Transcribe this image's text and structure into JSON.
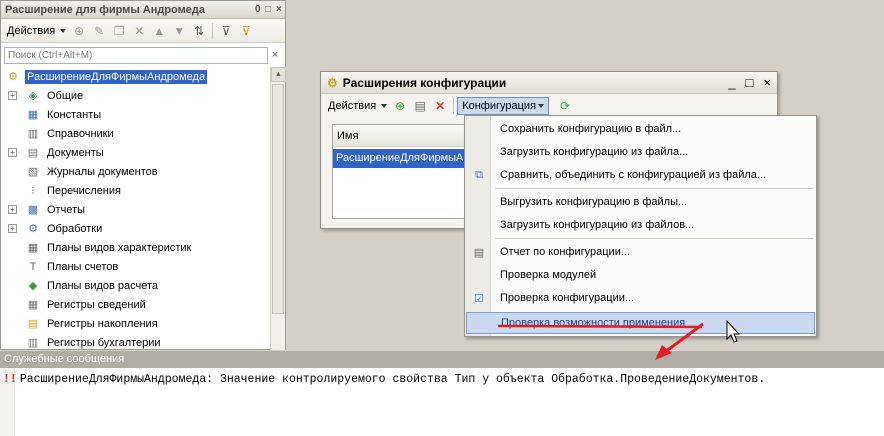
{
  "left_panel": {
    "title": "Расширение для фирмы Андромеда",
    "title_controls": [
      "0",
      "□",
      "×"
    ],
    "actions_label": "Действия",
    "search_placeholder": "Поиск (Ctrl+Alt+M)",
    "search_clear": "×",
    "tree": [
      {
        "label": "РасширениеДляФирмыАндромеда",
        "icon": "config-root-icon",
        "expand": false,
        "root": true
      },
      {
        "label": "Общие",
        "icon": "common-icon",
        "expand": true
      },
      {
        "label": "Константы",
        "icon": "constants-icon",
        "expand": false
      },
      {
        "label": "Справочники",
        "icon": "catalogs-icon",
        "expand": false
      },
      {
        "label": "Документы",
        "icon": "documents-icon",
        "expand": true
      },
      {
        "label": "Журналы документов",
        "icon": "journals-icon",
        "expand": false
      },
      {
        "label": "Перечисления",
        "icon": "enums-icon",
        "expand": false
      },
      {
        "label": "Отчеты",
        "icon": "reports-icon",
        "expand": true
      },
      {
        "label": "Обработки",
        "icon": "processings-icon",
        "expand": true
      },
      {
        "label": "Планы видов характеристик",
        "icon": "chart-types-icon",
        "expand": false
      },
      {
        "label": "Планы счетов",
        "icon": "accounts-icon",
        "expand": false
      },
      {
        "label": "Планы видов расчета",
        "icon": "calc-types-icon",
        "expand": false
      },
      {
        "label": "Регистры сведений",
        "icon": "info-registers-icon",
        "expand": false
      },
      {
        "label": "Регистры накопления",
        "icon": "accum-registers-icon",
        "expand": false
      },
      {
        "label": "Регистры бухгалтерии",
        "icon": "acc-registers-icon",
        "expand": false
      }
    ]
  },
  "dialog": {
    "title": "Расширения конфигурации",
    "controls": [
      "_",
      "□",
      "×"
    ],
    "actions_label": "Действия",
    "config_menu_label": "Конфигурация",
    "table_header": "Имя",
    "table_row": "РасширениеДляФирмыАндромеда"
  },
  "menu": {
    "items": [
      "Сохранить конфигурацию в файл...",
      "Загрузить конфигурацию из файла...",
      "Сравнить, объединить с конфигурацией из файла...",
      "Выгрузить конфигурацию в файлы...",
      "Загрузить конфигурацию из файлов...",
      "Отчет по конфигурации...",
      "Проверка модулей",
      "Проверка конфигурации...",
      "Проверка возможности применения"
    ]
  },
  "messages": {
    "header": "Служебные сообщения",
    "marker": "!!",
    "line": "РасширениеДляФирмыАндромеда: Значение контролируемого свойства Тип у объекта Обработка.ПроведениеДокументов."
  },
  "colors": {
    "selection": "#3163c5",
    "highlight": "#c9d9f0",
    "annotation": "#e02020"
  }
}
